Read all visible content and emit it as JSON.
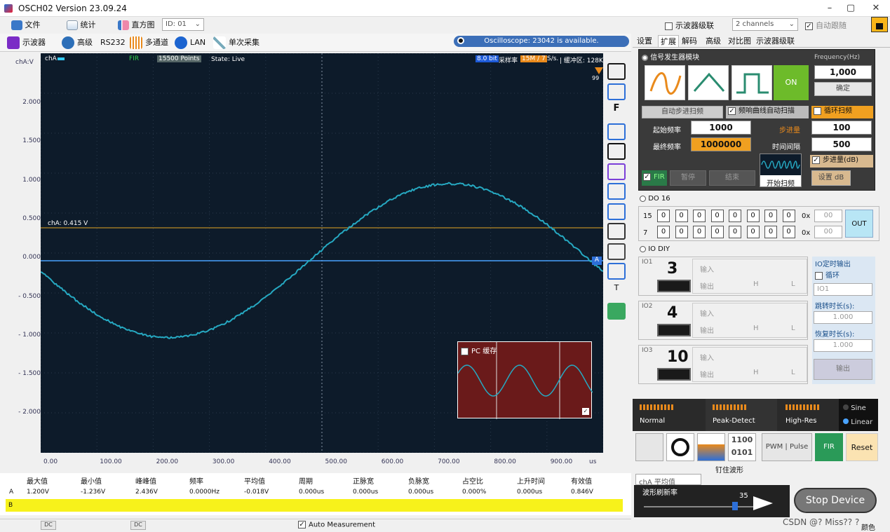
{
  "title": "OSCH02  Version 23.09.24",
  "cfg": {
    "cascade_label": "示波器级联",
    "channels": "2 channels",
    "auto_follow": "自动跟随"
  },
  "tabs": {
    "scope": "示波器",
    "advanced": "高级",
    "rs232": "RS232",
    "multichannel": "多通道",
    "lan": "LAN",
    "single": "单次采集",
    "file": "文件",
    "stats": "统计",
    "histogram": "直方图",
    "id": "ID: 01"
  },
  "status": "Oscilloscope: 23042 is available.",
  "scope": {
    "ch_label": "chA:V",
    "ch_tag": "chA",
    "fir": "FIR",
    "points": "15500 Points",
    "state": "State: Live",
    "bits": "8.0 bit",
    "samplerate_label": "采样率",
    "samplerate": "15M / 7",
    "sps": "S/s.",
    "buffer": "| 缓冲区: 128K",
    "cursor_label": "chA: 0.415 V",
    "marker_a": "A",
    "right_val": "99"
  },
  "y_ticks": [
    "2.000",
    "1.500",
    "1.000",
    "0.500",
    "0.000",
    "- 0.500",
    "- 1.000",
    "- 1.500",
    "- 2.000"
  ],
  "x_ticks": [
    "0.00",
    "100.00",
    "200.00",
    "300.00",
    "400.00",
    "500.00",
    "600.00",
    "700.00",
    "800.00",
    "900.00"
  ],
  "x_unit": "us",
  "pc_cache": "PC 缓存",
  "side_icons": [
    "fit-icon",
    "zoom-icon",
    "font-icon",
    "grid-icon",
    "span-icon",
    "spectrum-icon",
    "save-icon",
    "image-icon",
    "wave-icon",
    "table-icon",
    "ruler-icon",
    "text-icon",
    "tag-icon"
  ],
  "side_text": {
    "f": "F",
    "t": "T"
  },
  "right": {
    "tabs": [
      "设置",
      "扩展",
      "解码",
      "高级",
      "对比图",
      "示波器级联"
    ],
    "siggen": "信号发生器模块",
    "freq_label": "Frequency(Hz)",
    "freq": "1,000",
    "confirm": "确定",
    "on": "ON",
    "auto_step": "自动步进扫频",
    "auto_sweep": "频响曲线自动扫描",
    "loop_sweep": "循环扫频",
    "start_label": "起始频率",
    "start": "1000",
    "end_label": "最终频率",
    "end": "1000000",
    "step_label": "步进量",
    "step": "100",
    "interval_label": "时间间隔",
    "interval": "500",
    "step_db": "步进量(dB)",
    "fir": "FIR",
    "pause": "暂停",
    "stop": "结束",
    "start_sweep": "开始扫频",
    "set_db": "设置 dB",
    "do16": "DO 16",
    "row15": "15",
    "row7": "7",
    "ox": "0x",
    "hex1": "00",
    "hex2": "00",
    "out": "OUT",
    "bit0": "0",
    "iodiy": "IO DIY",
    "io": [
      {
        "name": "IO1",
        "num": "3"
      },
      {
        "name": "IO2",
        "num": "4"
      },
      {
        "name": "IO3",
        "num": "10"
      }
    ],
    "in": "输入",
    "outp": "输出",
    "h": "H",
    "l": "L",
    "timer_title": "IO定时输出",
    "loop": "循环",
    "io_sel": "IO1",
    "jump_label": "跳转时长(s):",
    "jump": "1.000",
    "recover_label": "恢复时长(s):",
    "recover": "1.000",
    "output": "输出",
    "modes": [
      "Normal",
      "Peak-Detect",
      "High-Res"
    ],
    "sine": "Sine",
    "linear": "Linear",
    "pwm": "PWM | Pulse",
    "fir2": "FIR",
    "reset": "Reset",
    "avg": "chA 平均值",
    "hold": "钉住波形",
    "refresh_label": "波形刷新率",
    "refresh": "35",
    "stop_device": "Stop Device",
    "color": "颜色",
    "watermark": "CSDN @? Miss?? ?"
  },
  "measure": {
    "headers": [
      "最大值",
      "最小值",
      "峰峰值",
      "频率",
      "平均值",
      "周期",
      "正脉宽",
      "负脉宽",
      "占空比",
      "上升时间",
      "有效值"
    ],
    "row_a_label": "A",
    "row_a": [
      "1.200V",
      "-1.236V",
      "2.436V",
      "0.0000Hz",
      "-0.018V",
      "0.000us",
      "0.000us",
      "0.000us",
      "0.000%",
      "0.000us",
      "0.846V"
    ],
    "row_b_label": "B"
  },
  "bottom": {
    "dc1": "DC",
    "dc2": "DC",
    "auto": "Auto Measurement"
  }
}
